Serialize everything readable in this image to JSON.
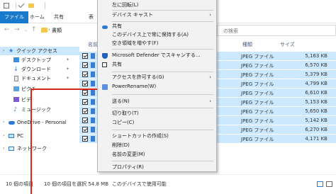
{
  "ribbon": {
    "tabs": [
      "ファイル",
      "ホーム",
      "共有",
      "表"
    ]
  },
  "address": {
    "path": "書類",
    "search_placeholder": "の検索"
  },
  "nav_pane": {
    "items": [
      {
        "label": "クイック アクセス"
      },
      {
        "label": "デスクトップ"
      },
      {
        "label": "ダウンロード"
      },
      {
        "label": "ドキュメント"
      },
      {
        "label": "ピクチ"
      },
      {
        "label": "ビデ"
      },
      {
        "label": "ミュージック"
      },
      {
        "label": "OneDrive - Personal"
      },
      {
        "label": "PC"
      },
      {
        "label": "ネットワーク"
      }
    ]
  },
  "file_list": {
    "columns": {
      "name": "名前",
      "type": "種類",
      "size": "サイズ"
    },
    "rows": [
      {
        "type": "JPEG ファイル",
        "size": "5,163 KB"
      },
      {
        "type": "JPEG ファイル",
        "size": "6,570 KB"
      },
      {
        "type": "JPEG ファイル",
        "size": "5,379 KB"
      },
      {
        "type": "JPEG ファイル",
        "size": "4,799 KB"
      },
      {
        "type": "JPEG ファイル",
        "size": "6,610 KB"
      },
      {
        "type": "JPEG ファイル",
        "size": "5,153 KB"
      },
      {
        "type": "JPEG ファイル",
        "size": "5,650 KB"
      },
      {
        "type": "JPEG ファイル",
        "size": "5,142 KB"
      },
      {
        "type": "JPEG ファイル",
        "size": "6,270 KB"
      },
      {
        "type": "JPEG ファイル",
        "size": "4,171 KB"
      }
    ]
  },
  "context_menu": {
    "items": [
      {
        "label": "左に回転(L)"
      },
      {
        "label": "デバイス キャスト",
        "arrow": "›"
      },
      {
        "label": "共有"
      },
      {
        "label": "このデバイス上で常に保持する(A)"
      },
      {
        "label": "空き領域を増やす(F)"
      },
      {
        "label": "Microsoft Defender でスキャンする..."
      },
      {
        "label": "共有"
      },
      {
        "label": "アクセスを許可する(G)",
        "arrow": "›"
      },
      {
        "label": "PowerRename(W)"
      },
      {
        "label": "送る(N)",
        "arrow": "›"
      },
      {
        "label": "切り取り(T)"
      },
      {
        "label": "コピー(C)"
      },
      {
        "label": "ショートカットの作成(S)"
      },
      {
        "label": "削除(D)"
      },
      {
        "label": "名前の変更(M)"
      },
      {
        "label": "プロパティ(R)"
      }
    ]
  },
  "status": {
    "item_count": "10 個の項目",
    "selected": "10 個の項目を選択  54.8 MB",
    "availability": "このデバイスで使用可能"
  },
  "colors": {
    "accent": "#1979ca",
    "selection": "#cce8ff",
    "annotation": "#d9261c"
  }
}
